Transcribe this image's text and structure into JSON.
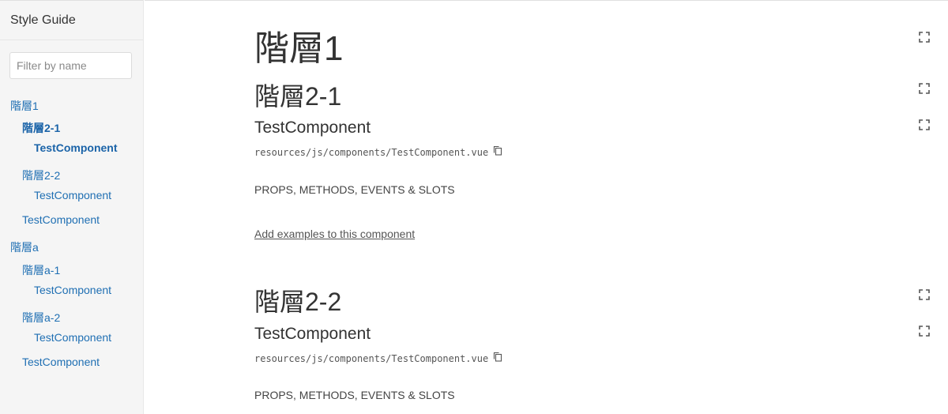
{
  "sidebar": {
    "title": "Style Guide",
    "filter_placeholder": "Filter by name",
    "items": [
      {
        "label": "階層1"
      },
      {
        "label": "階層2-1"
      },
      {
        "label": "TestComponent"
      },
      {
        "label": "階層2-2"
      },
      {
        "label": "TestComponent"
      },
      {
        "label": "TestComponent"
      },
      {
        "label": "階層a"
      },
      {
        "label": "階層a-1"
      },
      {
        "label": "TestComponent"
      },
      {
        "label": "階層a-2"
      },
      {
        "label": "TestComponent"
      },
      {
        "label": "TestComponent"
      }
    ]
  },
  "main": {
    "title": "階層1",
    "sections": [
      {
        "heading": "階層2-1",
        "component": {
          "name": "TestComponent",
          "path": "resources/js/components/TestComponent.vue",
          "props_label": "PROPS, METHODS, EVENTS & SLOTS",
          "add_examples": "Add examples to this component"
        }
      },
      {
        "heading": "階層2-2",
        "component": {
          "name": "TestComponent",
          "path": "resources/js/components/TestComponent.vue",
          "props_label": "PROPS, METHODS, EVENTS & SLOTS"
        }
      }
    ]
  },
  "icons": {
    "expand": "expand-icon",
    "copy": "copy-icon"
  },
  "colors": {
    "link": "#1f6fb3",
    "sidebar_bg": "#f5f5f5",
    "text": "#333333"
  }
}
